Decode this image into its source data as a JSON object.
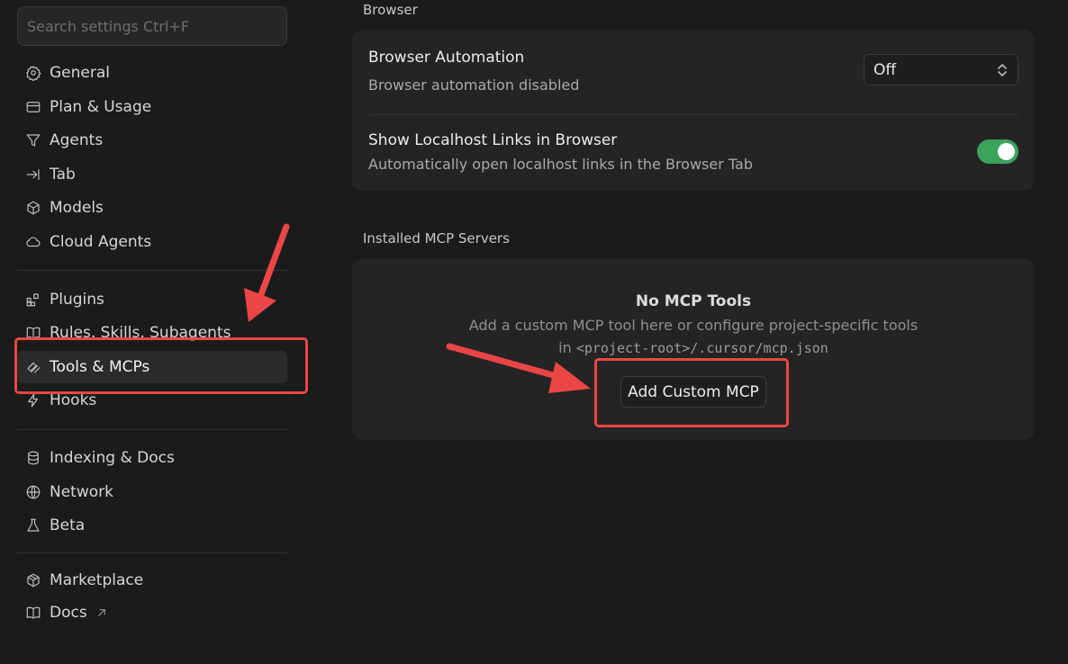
{
  "search": {
    "placeholder": "Search settings Ctrl+F"
  },
  "sidebar": {
    "groups": [
      {
        "items": [
          {
            "label": "General",
            "icon": "gear-icon"
          },
          {
            "label": "Plan & Usage",
            "icon": "card-icon"
          },
          {
            "label": "Agents",
            "icon": "agents-icon"
          },
          {
            "label": "Tab",
            "icon": "tab-arrow-icon"
          },
          {
            "label": "Models",
            "icon": "cube-icon"
          },
          {
            "label": "Cloud Agents",
            "icon": "cloud-icon"
          }
        ]
      },
      {
        "items": [
          {
            "label": "Plugins",
            "icon": "plugins-icon"
          },
          {
            "label": "Rules, Skills, Subagents",
            "icon": "book-icon"
          },
          {
            "label": "Tools & MCPs",
            "icon": "tools-icon",
            "active": true
          },
          {
            "label": "Hooks",
            "icon": "lightning-icon"
          }
        ]
      },
      {
        "items": [
          {
            "label": "Indexing & Docs",
            "icon": "database-icon"
          },
          {
            "label": "Network",
            "icon": "globe-icon"
          },
          {
            "label": "Beta",
            "icon": "flask-icon"
          }
        ]
      },
      {
        "items": [
          {
            "label": "Marketplace",
            "icon": "package-icon"
          },
          {
            "label": "Docs",
            "icon": "book-open-icon",
            "external_icon": "external-link-icon"
          }
        ]
      }
    ]
  },
  "browser_section": {
    "title": "Browser",
    "automation": {
      "title": "Browser Automation",
      "description": "Browser automation disabled",
      "selected": "Off"
    },
    "localhost": {
      "title": "Show Localhost Links in Browser",
      "description": "Automatically open localhost links in the Browser Tab",
      "enabled": true
    }
  },
  "mcp_section": {
    "title": "Installed MCP Servers",
    "empty_title": "No MCP Tools",
    "empty_desc_line1": "Add a custom MCP tool here or configure project-specific tools",
    "empty_desc_prefix": "in ",
    "empty_desc_path": "<project-root>/.cursor/mcp.json",
    "add_button": "Add Custom MCP"
  },
  "colors": {
    "accent_green": "#3aa35c",
    "annotation_red": "#ea4646",
    "background": "#1b1b1b",
    "card": "#242424"
  }
}
